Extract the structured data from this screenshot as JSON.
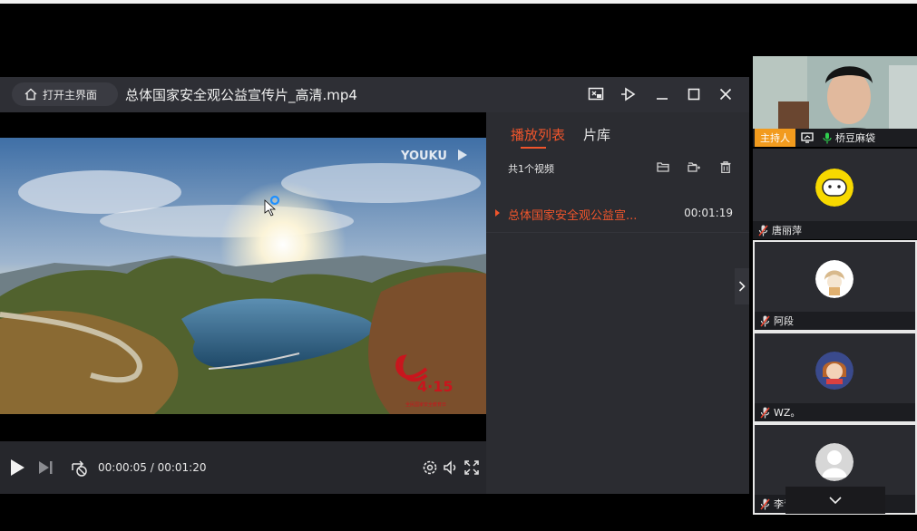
{
  "player": {
    "home_button": "打开主界面",
    "title": "总体国家安全观公益宣传片_高清.mp4",
    "video": {
      "watermark": "YOUKU",
      "badge_number": "4·15",
      "badge_caption": "全民国家安全教育日"
    },
    "time_display": "00:00:05 / 00:01:20",
    "progress": 0.06
  },
  "playlist": {
    "tab_playlist": "播放列表",
    "tab_library": "片库",
    "count_label": "共1个视频",
    "items": [
      {
        "name": "总体国家安全观公益宣...",
        "duration": "00:01:19"
      }
    ]
  },
  "participants": [
    {
      "name": "桥豆麻袋",
      "badge": "主持人"
    },
    {
      "name": "唐丽萍"
    },
    {
      "name": "阿段"
    },
    {
      "name": "WZ。"
    },
    {
      "name": "李青彦"
    }
  ],
  "colors": {
    "accent": "#f0552c",
    "host_badge": "#f29b1e",
    "mic": "#2fce4e"
  }
}
